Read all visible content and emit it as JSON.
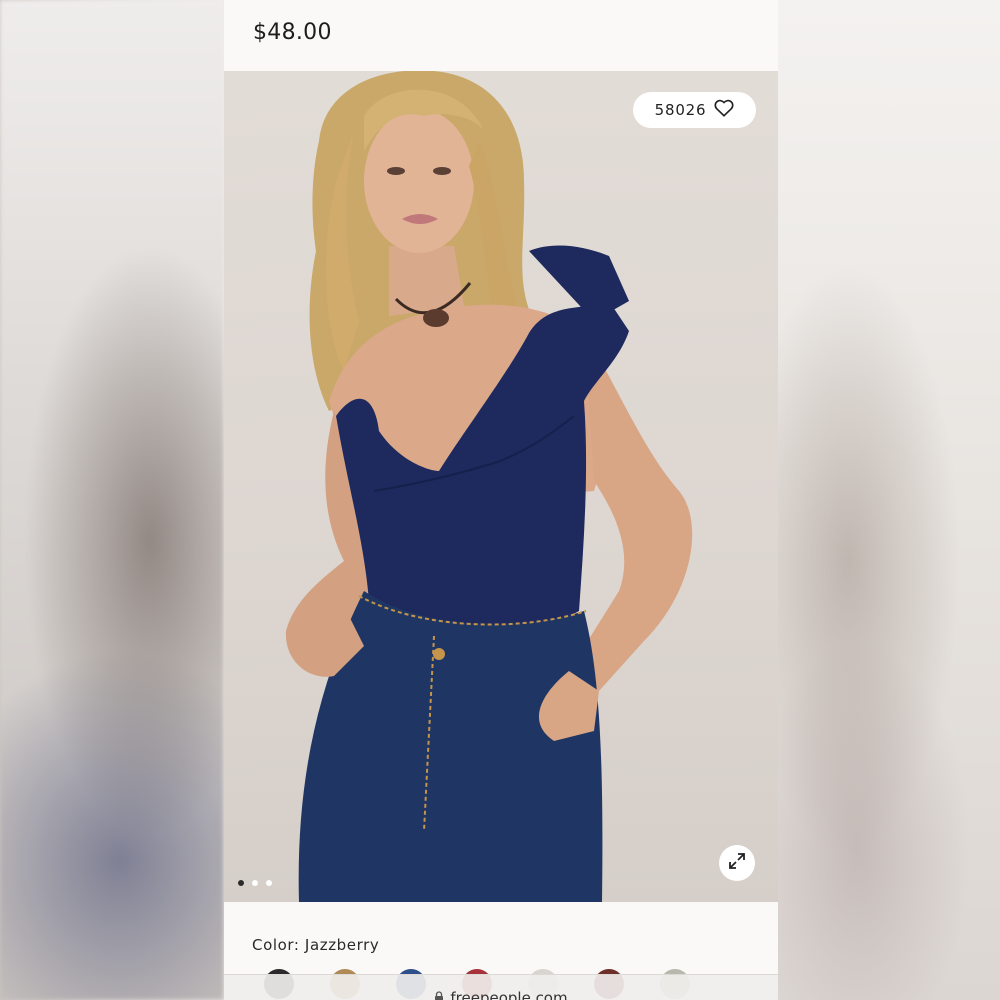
{
  "product": {
    "price": "$48.00",
    "color_label": "Color: Jazzberry",
    "favorites_count": "58026"
  },
  "gallery": {
    "total_images": 3,
    "active_index": 0
  },
  "swatches": [
    {
      "name": "black",
      "color": "#2a2a2a"
    },
    {
      "name": "tan",
      "color": "#b08a55"
    },
    {
      "name": "blue",
      "color": "#2e4f8c"
    },
    {
      "name": "red",
      "color": "#a8323a"
    },
    {
      "name": "light-gray",
      "color": "#d8d4d0"
    },
    {
      "name": "brown",
      "color": "#6e2f2a"
    },
    {
      "name": "sage",
      "color": "#b7b9ad"
    }
  ],
  "browser": {
    "url": "freepeople.com"
  },
  "icons": {
    "favorite": "heart-icon",
    "expand": "expand-icon",
    "lock": "lock-icon"
  },
  "colors": {
    "panel_bg": "#fbf9f8",
    "photo_bg": "#ddd6d1",
    "bodysuit": "#1e2a5e",
    "denim": "#1f3563"
  }
}
